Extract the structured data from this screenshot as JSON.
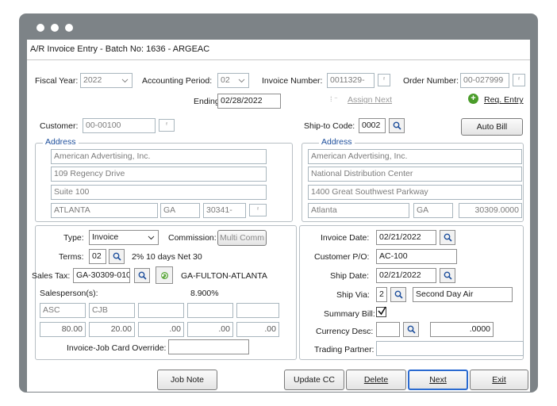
{
  "window": {
    "title": "A/R Invoice Entry - Batch No: 1636 - ARGEAC"
  },
  "header": {
    "fiscal_year_label": "Fiscal Year:",
    "fiscal_year": "2022",
    "period_label": "Accounting Period:",
    "period": "02",
    "ending_label": "Ending:",
    "ending": "02/28/2022",
    "invoice_number_label": "Invoice Number:",
    "invoice_number": "0011329-",
    "assign_next": "Assign Next",
    "order_number_label": "Order Number:",
    "order_number": "00-027999",
    "req_entry": "Req. Entry"
  },
  "customer": {
    "label": "Customer:",
    "value": "00-00100",
    "address_label": "Address",
    "name": "American Advertising, Inc.",
    "line1": "109 Regency Drive",
    "line2": "Suite 100",
    "city": "ATLANTA",
    "state": "GA",
    "zip": "30341-"
  },
  "shipto": {
    "label": "Ship-to Code:",
    "value": "0002",
    "auto_bill": "Auto Bill",
    "address_label": "Address",
    "name": "American Advertising, Inc.",
    "line1": "National Distribution Center",
    "line2": "1400 Great Southwest Parkway",
    "city": "Atlanta",
    "state": "GA",
    "zip": "30309.0000"
  },
  "left": {
    "type_label": "Type:",
    "type": "Invoice",
    "commission_label": "Commission:",
    "multi_comm": "Multi Comm",
    "terms_label": "Terms:",
    "terms": "02",
    "terms_desc": "2% 10 days Net 30",
    "sales_tax_label": "Sales Tax:",
    "sales_tax": "GA-30309-010",
    "sales_tax_desc": "GA-FULTON-ATLANTA",
    "salesperson_label": "Salesperson(s):",
    "rate": "8.900%",
    "salespersons": [
      "ASC",
      "CJB",
      "",
      "",
      ""
    ],
    "percents": [
      "80.00",
      "20.00",
      ".00",
      ".00",
      ".00"
    ],
    "override_label": "Invoice-Job Card Override:",
    "override": ""
  },
  "right": {
    "invoice_date_label": "Invoice Date:",
    "invoice_date": "02/21/2022",
    "customer_po_label": "Customer P/O:",
    "customer_po": "AC-100",
    "ship_date_label": "Ship Date:",
    "ship_date": "02/21/2022",
    "ship_via_label": "Ship Via:",
    "ship_via": "2",
    "ship_via_desc": "Second Day Air",
    "summary_bill_label": "Summary Bill:",
    "currency_label": "Currency Desc:",
    "currency_value": ".0000",
    "trading_partner_label": "Trading Partner:"
  },
  "buttons": {
    "job_note": "Job Note",
    "update_cc": "Update CC",
    "delete": "Delete",
    "next": "Next",
    "exit": "Exit"
  }
}
